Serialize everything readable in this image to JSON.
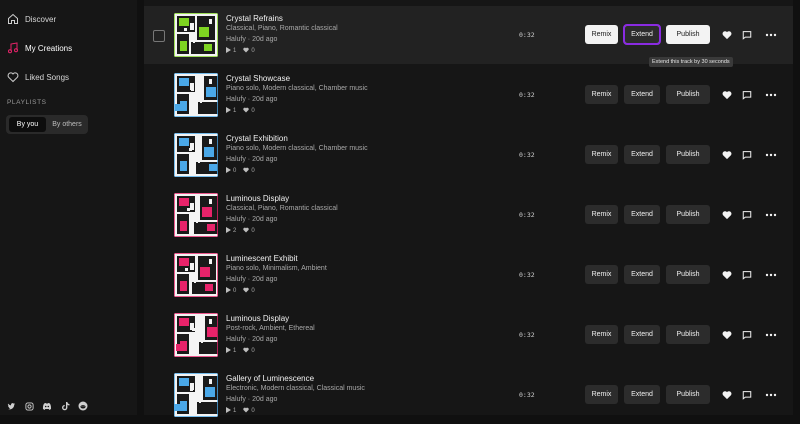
{
  "sidebar": {
    "nav": [
      {
        "label": "Discover",
        "icon": "home-icon"
      },
      {
        "label": "My Creations",
        "icon": "music-note-icon"
      },
      {
        "label": "Liked Songs",
        "icon": "heart-icon"
      }
    ],
    "playlists_label": "PLAYLISTS",
    "filter": {
      "selected": "By you",
      "other": "By others"
    },
    "social": [
      "twitter-icon",
      "instagram-icon",
      "discord-icon",
      "tiktok-icon",
      "reddit-icon"
    ]
  },
  "actions": {
    "remix": "Remix",
    "extend": "Extend",
    "publish": "Publish"
  },
  "tooltip": "Extend this track by 30 seconds",
  "tracks": [
    {
      "title": "Crystal Refrains",
      "tags": "Classical, Piano, Romantic classical",
      "author": "Halufy",
      "age": "20d ago",
      "plays": "1",
      "likes": "0",
      "duration": "0:32",
      "accent": "#7ed321"
    },
    {
      "title": "Crystal Showcase",
      "tags": "Piano solo, Modern classical, Chamber music",
      "author": "Halufy",
      "age": "20d ago",
      "plays": "1",
      "likes": "0",
      "duration": "0:32",
      "accent": "#4aa8e8"
    },
    {
      "title": "Crystal Exhibition",
      "tags": "Piano solo, Modern classical, Chamber music",
      "author": "Halufy",
      "age": "20d ago",
      "plays": "0",
      "likes": "0",
      "duration": "0:32",
      "accent": "#4aa8e8"
    },
    {
      "title": "Luminous Display",
      "tags": "Classical, Piano, Romantic classical",
      "author": "Halufy",
      "age": "20d ago",
      "plays": "2",
      "likes": "0",
      "duration": "0:32",
      "accent": "#e8236a"
    },
    {
      "title": "Luminescent Exhibit",
      "tags": "Piano solo, Minimalism, Ambient",
      "author": "Halufy",
      "age": "20d ago",
      "plays": "0",
      "likes": "0",
      "duration": "0:32",
      "accent": "#e8236a"
    },
    {
      "title": "Luminous Display",
      "tags": "Post-rock, Ambient, Ethereal",
      "author": "Halufy",
      "age": "20d ago",
      "plays": "1",
      "likes": "0",
      "duration": "0:32",
      "accent": "#e8236a"
    },
    {
      "title": "Gallery of Luminescence",
      "tags": "Electronic, Modern classical, Classical music",
      "author": "Halufy",
      "age": "20d ago",
      "plays": "1",
      "likes": "0",
      "duration": "0:32",
      "accent": "#4aa8e8"
    }
  ]
}
